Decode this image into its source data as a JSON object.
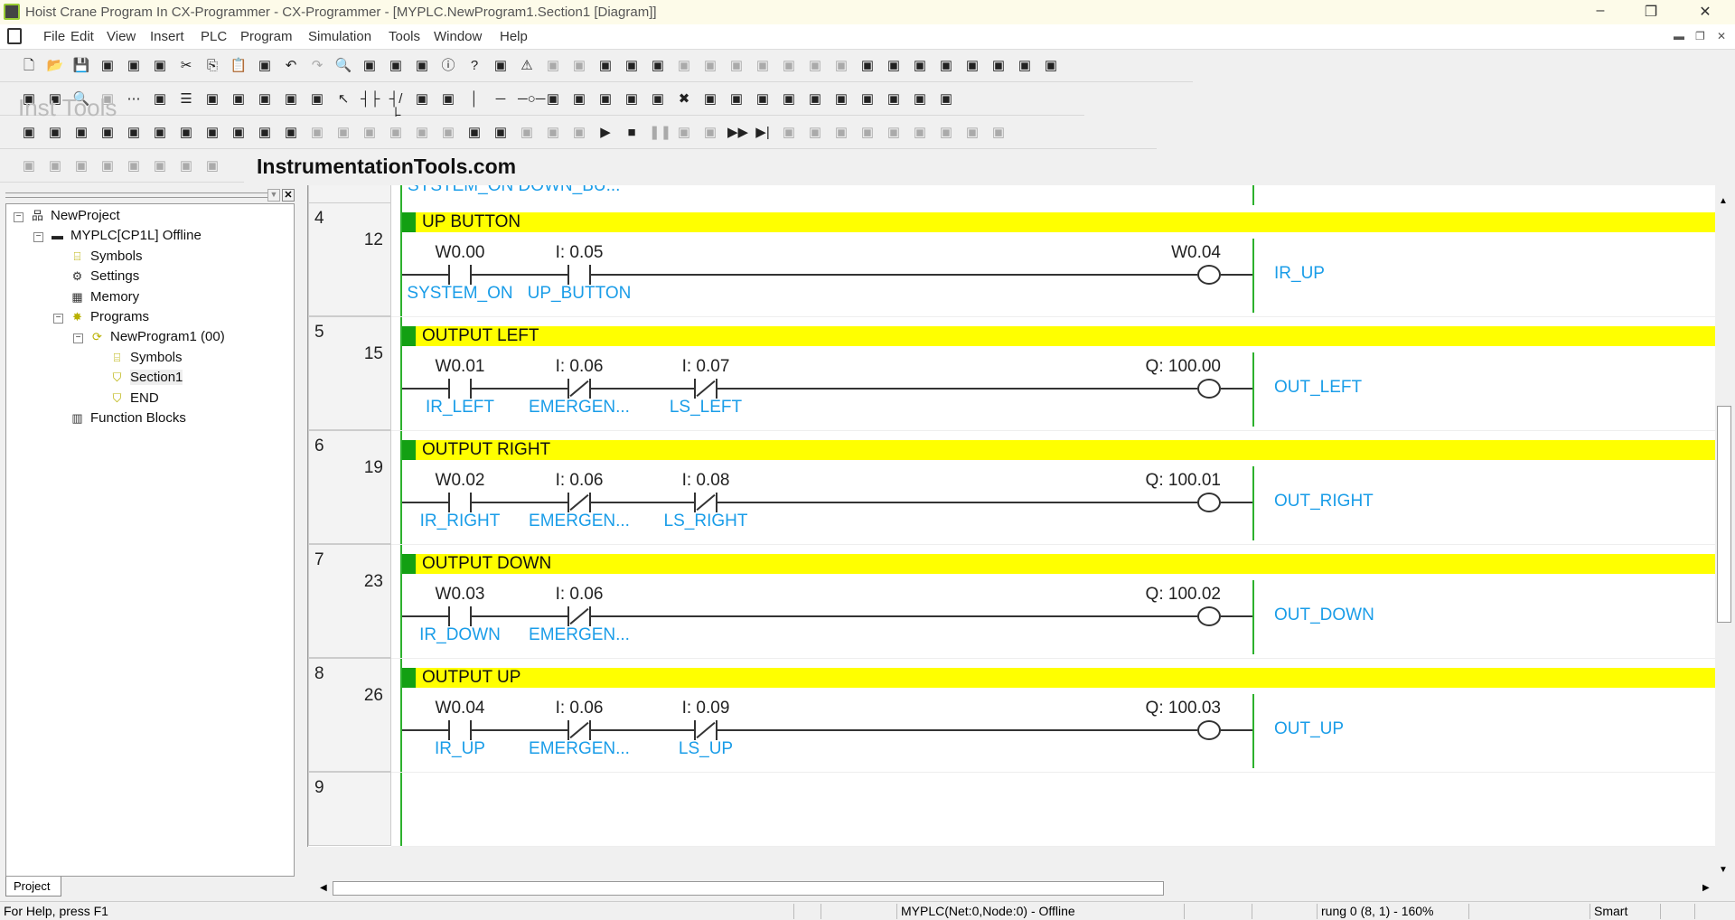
{
  "window": {
    "title": "Hoist Crane Program In CX-Programmer - CX-Programmer - [MYPLC.NewProgram1.Section1 [Diagram]]"
  },
  "menu": [
    "File",
    "Edit",
    "View",
    "Insert",
    "PLC",
    "Program",
    "Simulation",
    "Tools",
    "Window",
    "Help"
  ],
  "toolbars": {
    "row1": [
      "new-icon",
      "open-icon",
      "save-icon",
      "preview-icon",
      "print-icon",
      "print-preview-icon",
      "cut-icon",
      "copy-icon",
      "paste-icon",
      "paste-special-icon",
      "undo-icon",
      "redo-icon",
      "find-icon",
      "replace-icon",
      "cross-ref-icon",
      "address-ref-icon",
      "info-icon",
      "help-icon",
      "context-help-icon",
      "warning-icon",
      "compile-icon",
      "compile-all-icon",
      "program-check-icon",
      "plc-check-icon",
      "online-edit-icon",
      "pause-icon",
      "transfer-icon",
      "transfer-from-icon",
      "compare-icon",
      "monitor-icon",
      "monitor-all-icon",
      "diff-monitor-icon",
      "table-icon",
      "table2-icon",
      "table3-icon",
      "table4-icon",
      "switch-icon",
      "bit-icon",
      "lock-icon",
      "unlock-icon"
    ],
    "row2": [
      "zoom-in-icon",
      "zoom-fit-icon",
      "zoom-icon",
      "zoom-out-icon",
      "grid-icon",
      "comment-icon",
      "list-icon",
      "rung-icon",
      "bus-icon",
      "tree-icon",
      "sma-icon",
      "ci-icon",
      "select-icon",
      "no-contact-icon",
      "nc-contact-icon",
      "or-no-icon",
      "or-nc-icon",
      "vertical-icon",
      "horizontal-icon",
      "coil-icon",
      "nc-coil-icon",
      "instruction-icon",
      "fb-icon",
      "and-icon",
      "or-icon",
      "delete-icon",
      "prog-icon",
      "io-table-icon",
      "memory-icon",
      "expansion-icon",
      "unit-icon",
      "settings-icon",
      "ladder-icon",
      "fbd-icon",
      "error-icon",
      "st-icon"
    ],
    "row3": [
      "project-window-icon",
      "build-icon",
      "watch-icon",
      "xref-icon",
      "output-icon",
      "properties-icon",
      "io-comment-icon",
      "symbols-icon",
      "section-icon",
      "memory-view-icon",
      "data-trace-icon",
      "dec-10-icon",
      "dec-10b-icon",
      "hex-16-icon",
      "upload-icon",
      "download-icon",
      "forced-icon",
      "lock-program-icon",
      "protect-icon",
      "transfer-settings-icon",
      "hand-icon",
      "step-icon",
      "run-icon",
      "stop-icon",
      "pause-sim-icon",
      "step-in-icon",
      "step-out-icon",
      "fast-forward-icon",
      "run-to-end-icon",
      "sim-a-icon",
      "sim-b-icon",
      "sim-c-icon",
      "sim-d-icon",
      "sim-e-icon",
      "sim-f-icon",
      "sim-g-icon",
      "sim-h-icon",
      "return-icon"
    ],
    "row4": [
      "indent-left-icon",
      "indent-right-icon",
      "align-icon",
      "align2-icon",
      "mark-icon",
      "mark-next-icon",
      "mark-prev-icon",
      "mark-clear-icon"
    ]
  },
  "brand": "InstrumentationTools.com",
  "watermark": "Inst Tools",
  "project_tree": [
    {
      "label": "NewProject",
      "icon": "network-icon",
      "level": 0,
      "expander": "−"
    },
    {
      "label": "MYPLC[CP1L] Offline",
      "icon": "plc-icon",
      "level": 1,
      "expander": "−"
    },
    {
      "label": "Symbols",
      "icon": "symbols-icon",
      "level": 2
    },
    {
      "label": "Settings",
      "icon": "settings-icon",
      "level": 2
    },
    {
      "label": "Memory",
      "icon": "memory-icon",
      "level": 2
    },
    {
      "label": "Programs",
      "icon": "programs-icon",
      "level": 2,
      "expander": "−"
    },
    {
      "label": "NewProgram1 (00)",
      "icon": "program-icon",
      "level": 3,
      "expander": "−"
    },
    {
      "label": "Symbols",
      "icon": "symbols-icon",
      "level": 4
    },
    {
      "label": "Section1",
      "icon": "section-icon",
      "level": 4,
      "selected": true
    },
    {
      "label": "END",
      "icon": "section-icon",
      "level": 4
    },
    {
      "label": "Function Blocks",
      "icon": "function-blocks-icon",
      "level": 2
    }
  ],
  "project_tab": "Project",
  "partial_rung_text": "SYSTEM_ON  DOWN_BU...",
  "rungs": [
    {
      "rung": "4",
      "step": "12",
      "comment": "UP BUTTON",
      "contacts": [
        {
          "addr": "W0.00",
          "sym": "SYSTEM_ON",
          "type": "no"
        },
        {
          "addr": "I: 0.05",
          "sym": "UP_BUTTON",
          "type": "no"
        }
      ],
      "coil": {
        "addr": "W0.04",
        "sym": "IR_UP"
      }
    },
    {
      "rung": "5",
      "step": "15",
      "comment": "OUTPUT LEFT",
      "contacts": [
        {
          "addr": "W0.01",
          "sym": "IR_LEFT",
          "type": "no"
        },
        {
          "addr": "I: 0.06",
          "sym": "EMERGEN...",
          "type": "nc"
        },
        {
          "addr": "I: 0.07",
          "sym": "LS_LEFT",
          "type": "nc"
        }
      ],
      "coil": {
        "addr": "Q: 100.00",
        "sym": "OUT_LEFT"
      }
    },
    {
      "rung": "6",
      "step": "19",
      "comment": "OUTPUT RIGHT",
      "contacts": [
        {
          "addr": "W0.02",
          "sym": "IR_RIGHT",
          "type": "no"
        },
        {
          "addr": "I: 0.06",
          "sym": "EMERGEN...",
          "type": "nc"
        },
        {
          "addr": "I: 0.08",
          "sym": "LS_RIGHT",
          "type": "nc"
        }
      ],
      "coil": {
        "addr": "Q: 100.01",
        "sym": "OUT_RIGHT"
      }
    },
    {
      "rung": "7",
      "step": "23",
      "comment": "OUTPUT DOWN",
      "contacts": [
        {
          "addr": "W0.03",
          "sym": "IR_DOWN",
          "type": "no"
        },
        {
          "addr": "I: 0.06",
          "sym": "EMERGEN...",
          "type": "nc"
        }
      ],
      "coil": {
        "addr": "Q: 100.02",
        "sym": "OUT_DOWN"
      }
    },
    {
      "rung": "8",
      "step": "26",
      "comment": "OUTPUT UP",
      "contacts": [
        {
          "addr": "W0.04",
          "sym": "IR_UP",
          "type": "no"
        },
        {
          "addr": "I: 0.06",
          "sym": "EMERGEN...",
          "type": "nc"
        },
        {
          "addr": "I: 0.09",
          "sym": "LS_UP",
          "type": "nc"
        }
      ],
      "coil": {
        "addr": "Q: 100.03",
        "sym": "OUT_UP"
      }
    },
    {
      "rung": "9",
      "step": "",
      "comment": "",
      "contacts": [],
      "coil": null
    }
  ],
  "status": {
    "help": "For Help, press F1",
    "plc": "MYPLC(Net:0,Node:0) - Offline",
    "position": "rung 0 (8, 1)  - 160%",
    "mode": "Smart"
  },
  "colors": {
    "comment_bar": "#ffff00",
    "rail": "#2db12d",
    "symbol": "#1a9de8"
  }
}
